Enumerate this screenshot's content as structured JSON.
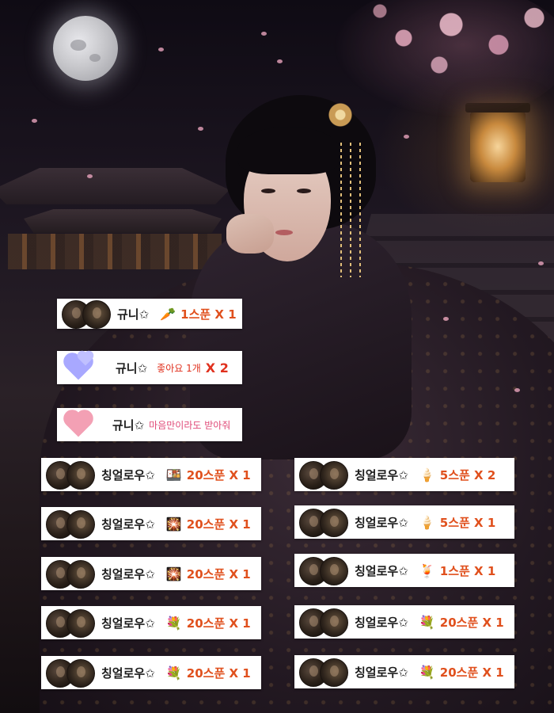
{
  "scene": {
    "description_icon": "moonlit-palace-illustration"
  },
  "colors": {
    "accent_orange": "#e0501d",
    "accent_red": "#e0301d",
    "accent_pink": "#e04a78",
    "card_bg": "#ffffff"
  },
  "left_cards": [
    {
      "name": "규니✩",
      "icon": "carrot-icon",
      "glyph": "🥕",
      "amount": "1스푼 X 1"
    },
    {
      "name": "규니✩",
      "icon": "purple-hearts-icon",
      "subtext": "좋아요 1개",
      "amount": "X 2"
    },
    {
      "name": "규니✩",
      "icon": "pink-heart-icon",
      "subtext": "마음만이라도 받아줘"
    },
    {
      "name": "칭얼로우✩",
      "icon": "lunchbox-icon",
      "glyph": "🍱",
      "amount": "20스푼 X 1"
    },
    {
      "name": "칭얼로우✩",
      "icon": "firework-icon",
      "glyph": "🎇",
      "amount": "20스푼 X 1"
    },
    {
      "name": "칭얼로우✩",
      "icon": "firework-icon",
      "glyph": "🎇",
      "amount": "20스푼 X 1"
    },
    {
      "name": "칭얼로우✩",
      "icon": "bouquet-icon",
      "glyph": "💐",
      "amount": "20스푼 X 1"
    },
    {
      "name": "칭얼로우✩",
      "icon": "bouquet-icon",
      "glyph": "💐",
      "amount": "20스푼 X 1"
    }
  ],
  "right_cards": [
    {
      "name": "칭얼로우✩",
      "icon": "ice-cream-icon",
      "glyph": "🍦",
      "amount": "5스푼 X 2"
    },
    {
      "name": "칭얼로우✩",
      "icon": "ice-cream-icon",
      "glyph": "🍦",
      "amount": "5스푼 X 1"
    },
    {
      "name": "칭얼로우✩",
      "icon": "juice-icon",
      "glyph": "🍹",
      "amount": "1스푼 X 1"
    },
    {
      "name": "칭얼로우✩",
      "icon": "bouquet-icon",
      "glyph": "💐",
      "amount": "20스푼 X 1"
    },
    {
      "name": "칭얼로우✩",
      "icon": "bouquet-icon",
      "glyph": "💐",
      "amount": "20스푼 X 1"
    }
  ]
}
